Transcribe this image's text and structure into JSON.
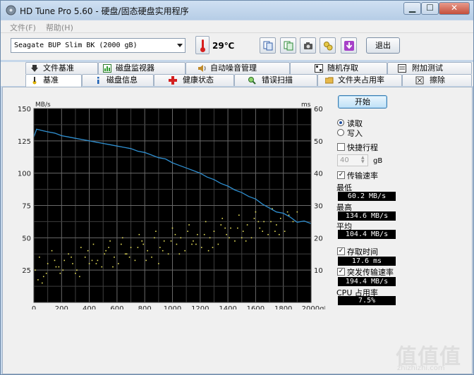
{
  "window": {
    "title": "HD Tune Pro 5.60 - 硬盘/固态硬盘实用程序",
    "min_label": "▁",
    "max_label": "☐",
    "close_label": "✕"
  },
  "menu": {
    "file": "文件(F)",
    "help": "帮助(H)"
  },
  "toolbar": {
    "drive": "Seagate BUP Slim BK (2000 gB)",
    "temperature": "29℃",
    "exit_label": "退出",
    "icons": [
      "copy-info-icon",
      "copy-all-icon",
      "camera-icon",
      "options-icon",
      "save-icon"
    ]
  },
  "tabs_top": [
    {
      "label": "文件基准",
      "icon": "file-benchmark-icon"
    },
    {
      "label": "磁盘监视器",
      "icon": "disk-monitor-icon"
    },
    {
      "label": "自动噪音管理",
      "icon": "speaker-icon"
    },
    {
      "label": "随机存取",
      "icon": "random-access-icon"
    },
    {
      "label": "附加测试",
      "icon": "extra-tests-icon"
    }
  ],
  "tabs_bottom": [
    {
      "label": "基准",
      "icon": "benchmark-icon"
    },
    {
      "label": "磁盘信息",
      "icon": "info-icon"
    },
    {
      "label": "健康状态",
      "icon": "health-icon"
    },
    {
      "label": "错误扫描",
      "icon": "error-scan-icon"
    },
    {
      "label": "文件夹占用率",
      "icon": "folder-icon"
    },
    {
      "label": "擦除",
      "icon": "erase-icon"
    }
  ],
  "panel": {
    "start_label": "开始",
    "read_label": "读取",
    "write_label": "写入",
    "short_stroke_label": "快捷行程",
    "short_stroke_value": "40",
    "short_stroke_unit": "gB",
    "transfer_rate_label": "传输速率",
    "min_label": "最低",
    "min_value": "60.2 MB/s",
    "max_label": "最高",
    "max_value": "134.6 MB/s",
    "avg_label": "平均",
    "avg_value": "104.4 MB/s",
    "access_time_label": "存取时间",
    "access_time_value": "17.6 ms",
    "burst_label": "突发传输速率",
    "burst_value": "194.4 MB/s",
    "cpu_label": "CPU 占用率",
    "cpu_value": "7.5%"
  },
  "watermark": {
    "big": "值值值",
    "small": "zhizhizhi.com"
  },
  "chart_data": {
    "type": "line",
    "ylabel_left": "MB/s",
    "ylabel_right": "ms",
    "xlim": [
      0,
      2000
    ],
    "ylim_left": [
      0,
      150
    ],
    "ylim_right": [
      0,
      60
    ],
    "x_ticks": [
      "0",
      "200",
      "400",
      "600",
      "800",
      "1000",
      "1200",
      "1400",
      "1600",
      "1800",
      "2000gB"
    ],
    "y_ticks_left": [
      "150",
      "125",
      "100",
      "75",
      "50",
      "25"
    ],
    "y_ticks_right": [
      "60",
      "50",
      "40",
      "30",
      "20",
      "10"
    ],
    "grid": true,
    "series": [
      {
        "name": "传输速率",
        "color": "#2f8fd0",
        "x": [
          0,
          20,
          60,
          100,
          150,
          200,
          250,
          300,
          350,
          400,
          450,
          500,
          550,
          600,
          650,
          700,
          750,
          800,
          850,
          900,
          950,
          1000,
          1050,
          1100,
          1150,
          1200,
          1250,
          1300,
          1350,
          1400,
          1450,
          1500,
          1550,
          1600,
          1650,
          1700,
          1750,
          1800,
          1850,
          1900,
          1950,
          2000
        ],
        "values": [
          128,
          134,
          133,
          132,
          131,
          129,
          128,
          127,
          126,
          125,
          124,
          123,
          122,
          121,
          120,
          119,
          117,
          116,
          114,
          112,
          111,
          108,
          106,
          104,
          102,
          100,
          97,
          95,
          92,
          90,
          87,
          85,
          82,
          80,
          76,
          73,
          70,
          69,
          66,
          62,
          63,
          61
        ]
      },
      {
        "name": "存取时间",
        "color": "#e8e05a",
        "style": "scatter",
        "axis": "right",
        "x": [
          10,
          40,
          70,
          100,
          130,
          160,
          190,
          220,
          250,
          280,
          310,
          340,
          370,
          400,
          430,
          460,
          490,
          520,
          550,
          580,
          610,
          640,
          670,
          700,
          730,
          760,
          790,
          820,
          850,
          880,
          910,
          940,
          970,
          1000,
          1030,
          1060,
          1090,
          1120,
          1150,
          1180,
          1210,
          1240,
          1270,
          1300,
          1330,
          1360,
          1390,
          1420,
          1450,
          1480,
          1510,
          1540,
          1570,
          1600,
          1630,
          1660,
          1690,
          1720,
          1750,
          1780,
          1810,
          1840,
          1870,
          1900,
          30,
          90,
          150,
          210,
          270,
          330,
          390,
          450,
          510,
          570,
          630,
          690,
          750,
          810,
          870,
          930,
          990,
          1050,
          1110,
          1170,
          1230,
          1290,
          1350,
          1410,
          1470,
          1530,
          1590,
          1650,
          1710,
          1770,
          1830,
          60,
          180,
          300,
          420,
          540,
          660,
          780,
          900,
          1020,
          1140,
          1260,
          1380,
          1500,
          1620,
          1740
        ],
        "values": [
          10,
          14,
          8,
          12,
          16,
          11,
          9,
          13,
          15,
          12,
          10,
          17,
          14,
          12,
          18,
          13,
          11,
          16,
          19,
          14,
          12,
          20,
          15,
          17,
          13,
          21,
          18,
          16,
          14,
          22,
          17,
          19,
          15,
          23,
          18,
          20,
          16,
          24,
          19,
          21,
          17,
          25,
          20,
          22,
          18,
          26,
          21,
          23,
          19,
          27,
          22,
          24,
          20,
          28,
          23,
          25,
          21,
          29,
          24,
          26,
          22,
          27,
          25,
          28,
          7,
          9,
          13,
          10,
          14,
          8,
          16,
          12,
          15,
          11,
          18,
          14,
          17,
          13,
          20,
          16,
          19,
          15,
          22,
          18,
          21,
          17,
          24,
          20,
          23,
          19,
          26,
          22,
          25,
          21,
          28,
          6,
          11,
          9,
          13,
          17,
          15,
          19,
          12,
          21,
          18,
          16,
          23,
          20,
          25,
          22
        ]
      }
    ]
  }
}
